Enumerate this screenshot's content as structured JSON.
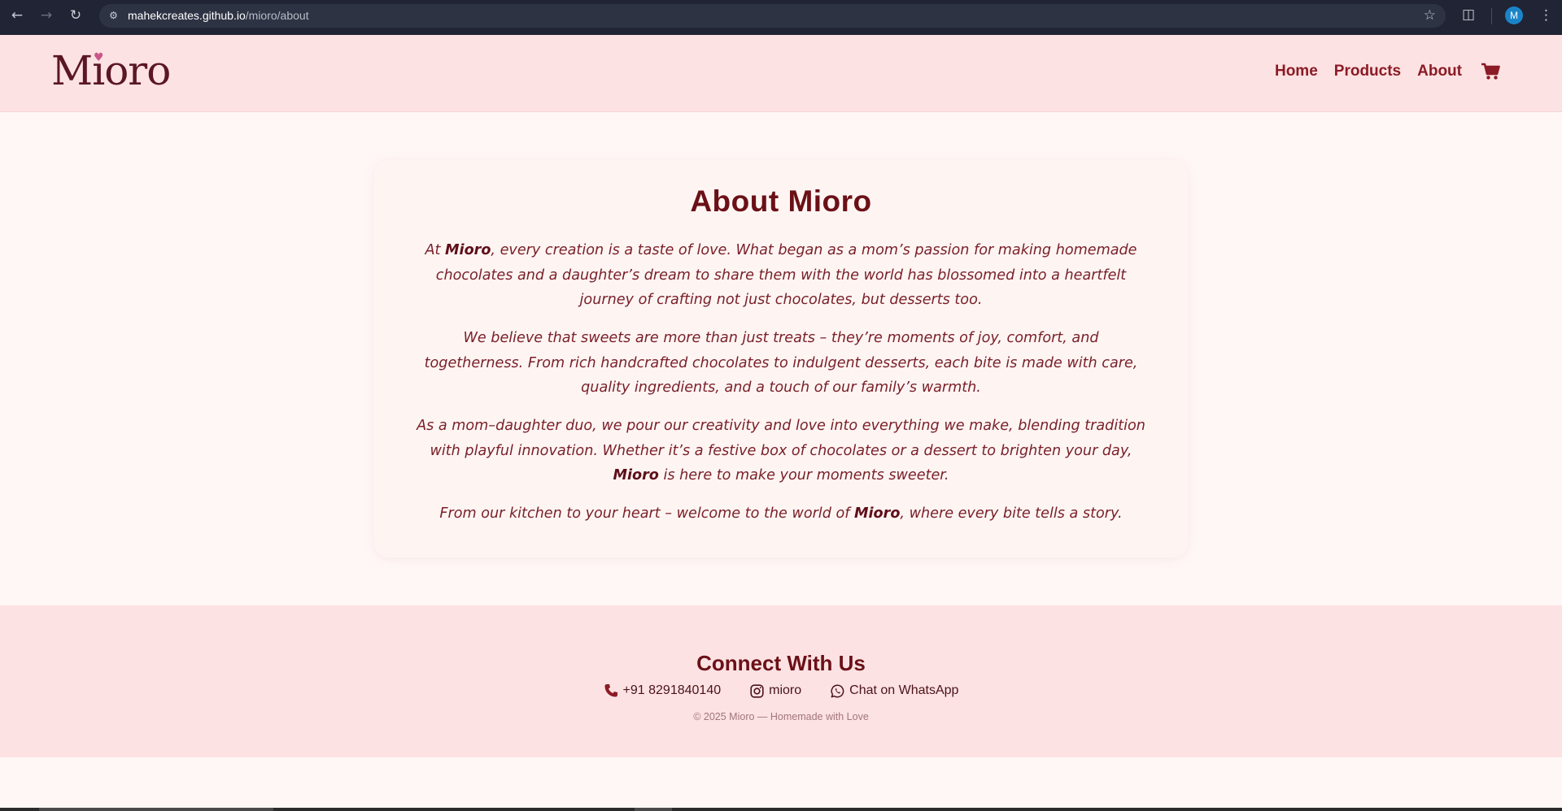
{
  "browser": {
    "url_host": "mahekcreates.github.io",
    "url_path": "/mioro/about",
    "profile_initial": "M",
    "icons": [
      "back-arrow-icon",
      "forward-arrow-icon",
      "reload-icon",
      "site-settings-icon",
      "bookmark-star-icon",
      "extensions-icon",
      "more-menu-icon"
    ]
  },
  "header": {
    "logo_text": "Mioro",
    "nav": {
      "home": "Home",
      "products": "Products",
      "about": "About"
    },
    "cart_icon": "shopping-cart-icon"
  },
  "about": {
    "title": "About Mioro",
    "p1": {
      "a": "At ",
      "brand": "Mioro",
      "b": ", every creation is a taste of love. What began as a mom’s passion for making homemade chocolates and a daughter’s dream to share them with the world has blossomed into a heartfelt journey of crafting not just chocolates, but desserts too."
    },
    "p2": "We believe that sweets are more than just treats – they’re moments of joy, comfort, and togetherness. From rich handcrafted chocolates to indulgent desserts, each bite is made with care, quality ingredients, and a touch of our family’s warmth.",
    "p3": {
      "a": "As a mom–daughter duo, we pour our creativity and love into everything we make, blending tradition with playful innovation. Whether it’s a festive box of chocolates or a dessert to brighten your day, ",
      "brand": "Mioro",
      "b": " is here to make your moments sweeter."
    },
    "p4": {
      "a": "From our kitchen to your heart – welcome to the world of ",
      "brand": "Mioro",
      "b": ", where every bite tells a story."
    }
  },
  "footer": {
    "title": "Connect With Us",
    "phone": "+91 8291840140",
    "instagram": "mioro",
    "whatsapp": "Chat on WhatsApp",
    "copyright": "© 2025 Mioro — Homemade with Love",
    "icons": [
      "phone-icon",
      "instagram-icon",
      "whatsapp-icon"
    ]
  },
  "colors": {
    "header_bg": "#fde2e3",
    "page_bg": "#fff7f6",
    "accent": "#8b1b25",
    "heading": "#6b1017"
  }
}
